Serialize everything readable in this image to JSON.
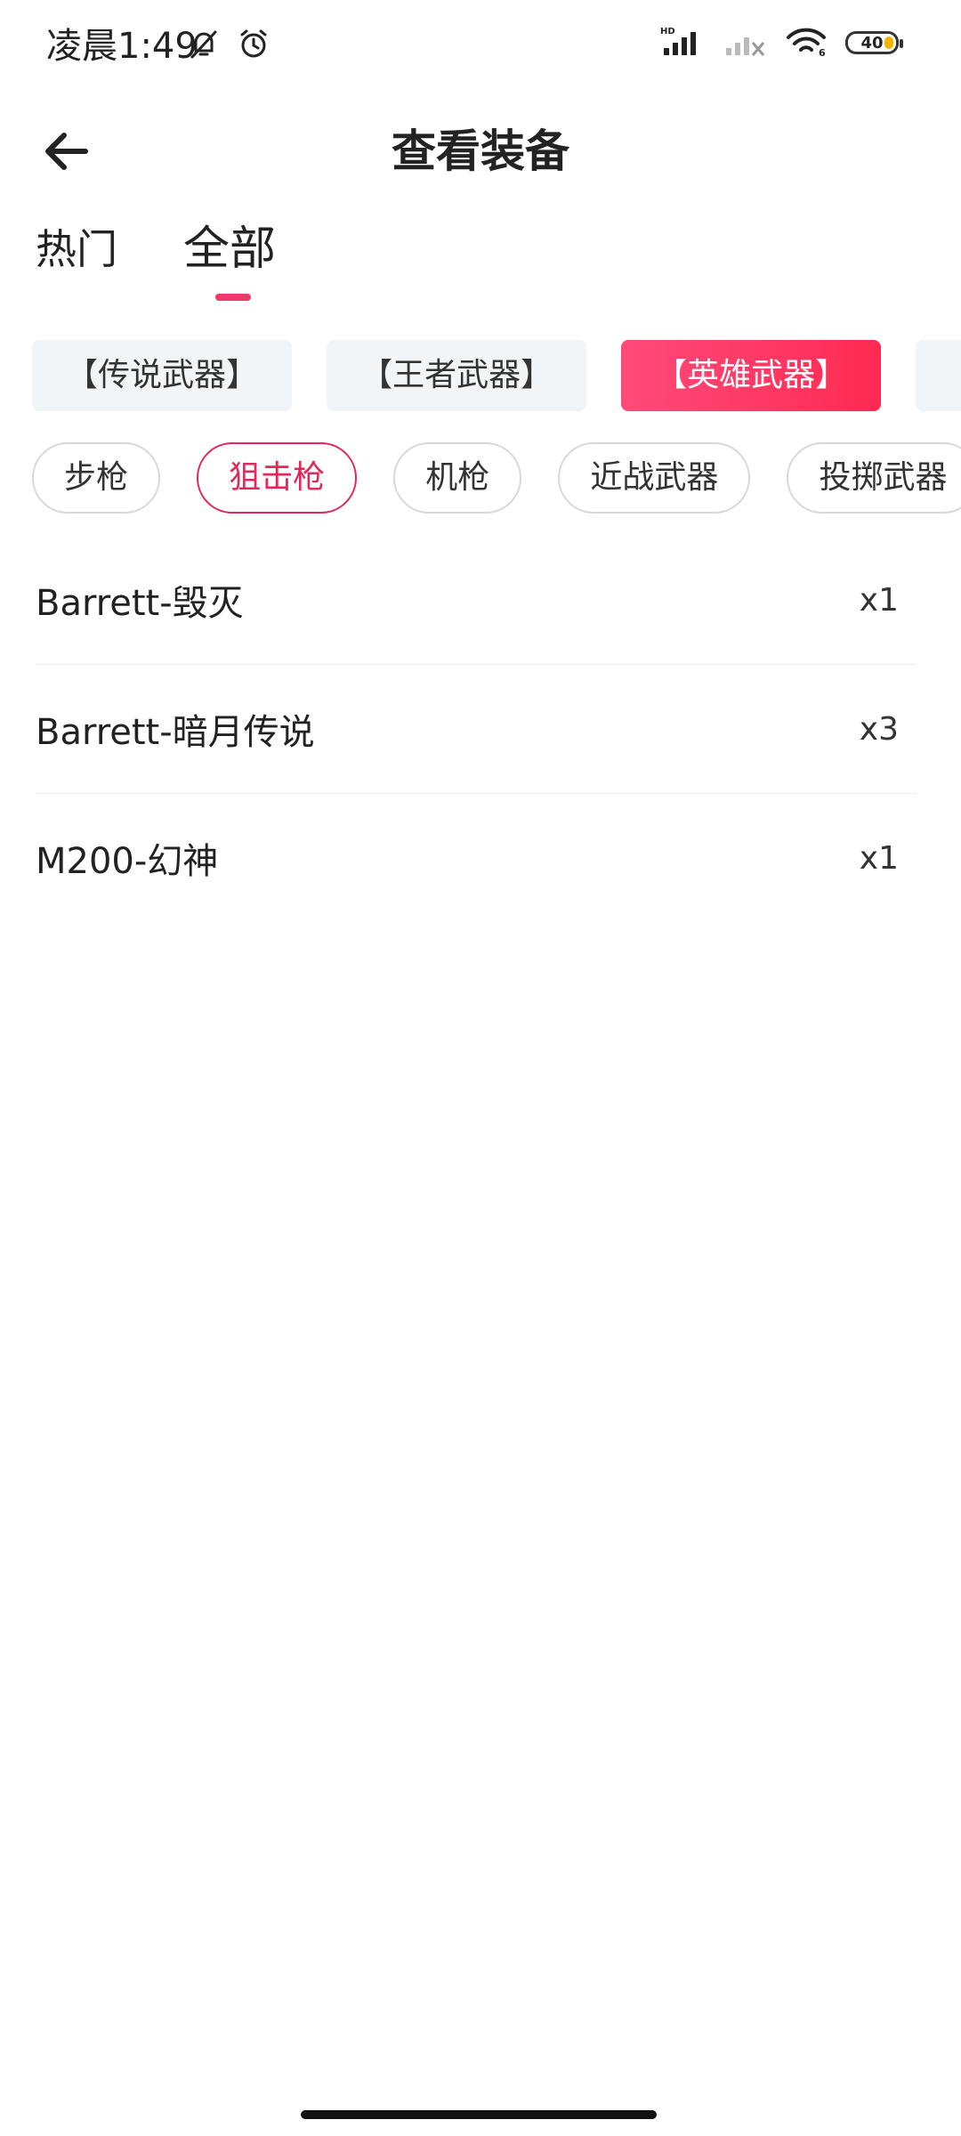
{
  "status_bar": {
    "time": "凌晨1:49",
    "battery": "40"
  },
  "header": {
    "title": "查看装备"
  },
  "tabs": [
    {
      "label": "热门",
      "active": false
    },
    {
      "label": "全部",
      "active": true
    }
  ],
  "categories": [
    {
      "label": "【传说武器】",
      "active": false
    },
    {
      "label": "【王者武器】",
      "active": false
    },
    {
      "label": "【英雄武器】",
      "active": true
    },
    {
      "label": "【",
      "active": false
    }
  ],
  "filters": [
    {
      "label": "步枪",
      "active": false
    },
    {
      "label": "狙击枪",
      "active": true
    },
    {
      "label": "机枪",
      "active": false
    },
    {
      "label": "近战武器",
      "active": false
    },
    {
      "label": "投掷武器",
      "active": false
    }
  ],
  "items": [
    {
      "name": "Barrett-毁灭",
      "count": "x1"
    },
    {
      "name": "Barrett-暗月传说",
      "count": "x3"
    },
    {
      "name": "M200-幻神",
      "count": "x1"
    }
  ],
  "colors": {
    "accent": "#f0386b",
    "chip_active_start": "#ff4a7a",
    "chip_active_end": "#ff2a52",
    "chip_bg": "#f2f5f8",
    "battery_fill": "#f5b400"
  }
}
